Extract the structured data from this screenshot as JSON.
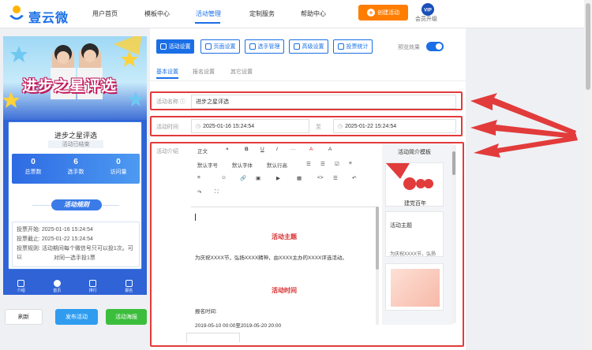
{
  "header": {
    "brand": "壹云微",
    "nav": [
      "用户首页",
      "模板中心",
      "活动管理",
      "定制服务",
      "帮助中心"
    ],
    "active_nav": "活动管理",
    "create_button": "创建活动",
    "vip_badge": "VIP",
    "vip_label": "会员升级"
  },
  "preview": {
    "banner_title": "进步之星评选",
    "card_title": "进步之星评选",
    "status": "活动已结束",
    "stats": [
      {
        "num": "0",
        "label": "总票数"
      },
      {
        "num": "6",
        "label": "选手数"
      },
      {
        "num": "0",
        "label": "访问量"
      }
    ],
    "rules_button": "活动规则",
    "info_rows": [
      "投票开始: 2025-01-16 15:24:54",
      "投票截止: 2025-01-22 15:24:54",
      "投票规则: 活动期间每个微信号只可以投1次。可以",
      "对同一选手投1票"
    ],
    "bottom_tabs": [
      "介绍",
      "首页",
      "排行",
      "报名"
    ]
  },
  "left_buttons": {
    "refresh": "刷新",
    "publish": "发布活动",
    "poster": "活动海报"
  },
  "toolbar": {
    "tabs": [
      "活动设置",
      "页面设置",
      "选手管理",
      "高级设置",
      "投票统计"
    ],
    "preview_label": "预览效果",
    "preview_on": true
  },
  "subtabs": [
    "基本设置",
    "报名设置",
    "其它设置"
  ],
  "form": {
    "name_label": "活动名称",
    "name_value": "进步之星评选",
    "time_label": "活动时间",
    "start_time": "2025-01-16 15:24:54",
    "to_label": "至",
    "end_time": "2025-01-22 15:24:54",
    "intro_label": "活动介绍"
  },
  "editor_toolbar": {
    "row1": [
      "正文",
      "❝",
      "B",
      "U",
      "I",
      "···",
      "A",
      "A"
    ],
    "row2": [
      "默认字号",
      "默认字体",
      "默认行高",
      "☰",
      "☰",
      "☑",
      "≡"
    ],
    "row3": [
      "≡",
      "☺",
      "🔗",
      "▣",
      "▶",
      "▦",
      "<>",
      "☰",
      "↶"
    ],
    "row4": [
      "↷",
      "⛶"
    ]
  },
  "editor_content": {
    "heading1": "活动主题",
    "body1": "为庆祝XXXX节，弘扬XXXX精神，由XXXX主办的XXXX评选活动。",
    "heading2": "活动时间",
    "body2": "报名时间:",
    "body3": "2019-05-10 00:00至2019-05-20 20:00"
  },
  "templates": {
    "title": "活动简介模板",
    "items": [
      "建党百年",
      "活动主题",
      "为庆祝XXXX节，弘扬"
    ]
  }
}
